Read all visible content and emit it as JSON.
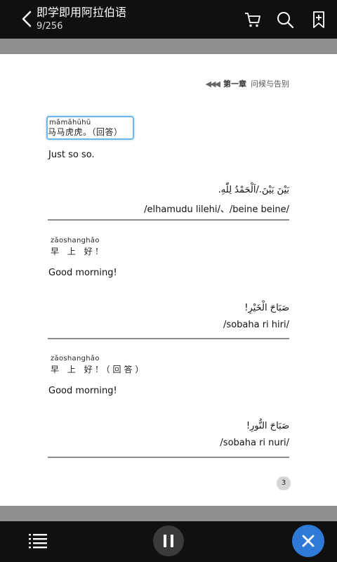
{
  "header": {
    "title": "即学即用阿拉伯语",
    "page_counter": "9/256",
    "icons": [
      "back-arrow-icon",
      "cart-icon",
      "search-icon",
      "bookmark-add-icon"
    ]
  },
  "chapter": {
    "arrows": "◀◀◀",
    "number": "第一章",
    "name": "问候与告别"
  },
  "entries": [
    {
      "pinyin": "mǎmǎhūhū",
      "hanzi": "马马虎虎。（回答）",
      "english": "Just so so.",
      "arabic": "بَيْنَ بَيْنَ./اَلْحَمْدُ لِلّٰهِ.",
      "transliteration": "/elhamudu lilehi/、/beine beine/"
    },
    {
      "pinyin": "zǎoshanghǎo",
      "hanzi": "早 上 好!",
      "english": "Good morning!",
      "arabic": "صَبَاحَ الْخَيْرِ!",
      "transliteration": "/sobaha ri hiri/"
    },
    {
      "pinyin": "zǎoshanghǎo",
      "hanzi": "早 上 好!（回答）",
      "english": "Good morning!",
      "arabic": "صَبَاحَ النُّورِ!",
      "transliteration": "/sobaha ri nuri/"
    }
  ],
  "page_number": "3",
  "footer": {
    "icons": [
      "list-icon",
      "pause-icon",
      "close-icon"
    ]
  },
  "colors": {
    "bar": "#101010",
    "gutter": "#8f8f8f",
    "highlight": "#6fb6e6",
    "close_button": "#2f7ad6"
  }
}
